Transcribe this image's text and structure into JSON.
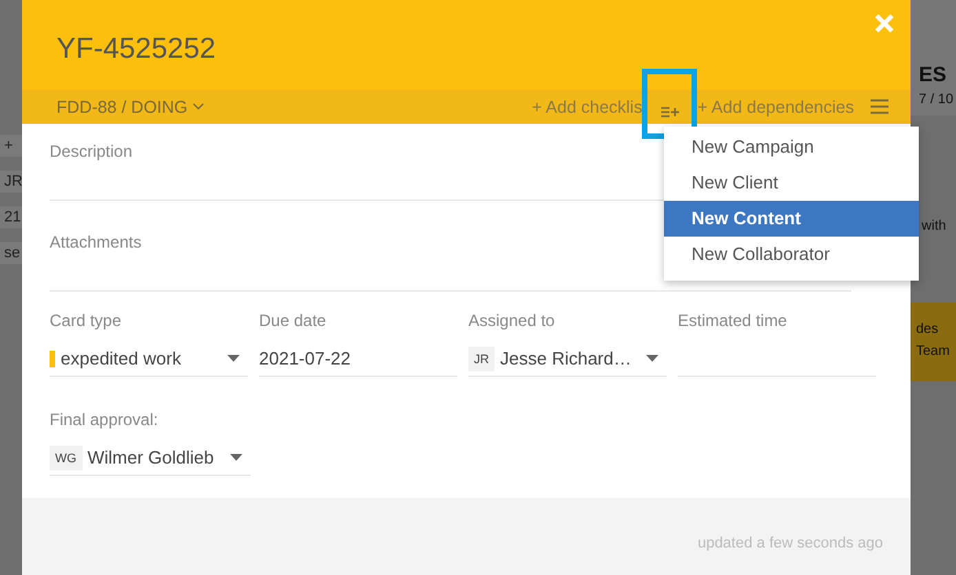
{
  "background": {
    "left_fragments": [
      "+",
      "JR",
      "21",
      "se"
    ],
    "right_fragments": [
      "ES",
      "7 / 10",
      "with",
      "des",
      "Team"
    ]
  },
  "card": {
    "title": "YF-4525252",
    "breadcrumb": "FDD-88 / DOING",
    "actions": [
      {
        "kind": "link",
        "label": "+ Add checklis"
      },
      {
        "kind": "icon",
        "highlighted": true
      },
      {
        "kind": "link",
        "label": "+ Add dependencies"
      },
      {
        "kind": "menu"
      }
    ],
    "sections": [
      "Description",
      "Attachments"
    ],
    "fields": [
      {
        "kind": "select",
        "label": "Card type",
        "value": "expedited work",
        "color": "#fbbf0c"
      },
      {
        "kind": "text",
        "label": "Due date",
        "value": "2021-07-22"
      },
      {
        "kind": "user",
        "label": "Assigned to",
        "initials": "JR",
        "value": "Jesse Richard…"
      },
      {
        "kind": "text",
        "label": "Estimated time"
      }
    ],
    "final_approval": {
      "label": "Final approval:",
      "initials": "WG",
      "value": "Wilmer Goldlieb"
    },
    "footer": "updated a few seconds ago"
  },
  "menu": {
    "items": [
      {
        "label": "New Campaign",
        "selected": false
      },
      {
        "label": "New Client",
        "selected": false
      },
      {
        "label": "New Content",
        "selected": true
      },
      {
        "label": "New Collaborator",
        "selected": false
      }
    ]
  }
}
